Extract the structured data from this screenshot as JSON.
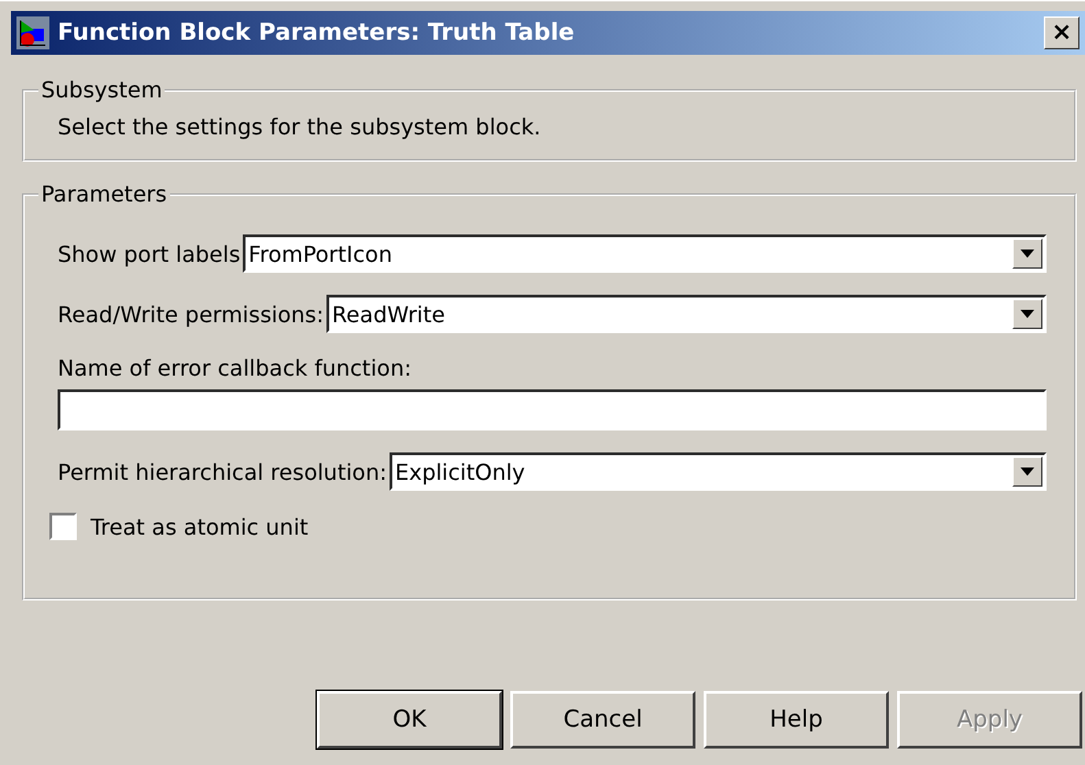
{
  "window": {
    "title": "Function Block Parameters: Truth Table",
    "close": "×"
  },
  "subsystem": {
    "legend": "Subsystem",
    "description": "Select the settings for the subsystem block."
  },
  "parameters": {
    "legend": "Parameters",
    "fields": [
      {
        "kind": "dropdown",
        "label": "Show port labels",
        "value": "FromPortIcon"
      },
      {
        "kind": "dropdown",
        "label": "Read/Write permissions:",
        "value": "ReadWrite"
      },
      {
        "kind": "text",
        "label": "Name of error callback function:"
      },
      {
        "kind": "dropdown",
        "label": "Permit hierarchical resolution:",
        "value": "ExplicitOnly"
      },
      {
        "kind": "checkbox",
        "label": "Treat as atomic unit",
        "checked": false
      }
    ]
  },
  "buttons": [
    {
      "label": "OK",
      "default": true,
      "disabled": false
    },
    {
      "label": "Cancel",
      "default": false,
      "disabled": false
    },
    {
      "label": "Help",
      "default": false,
      "disabled": false
    },
    {
      "label": "Apply",
      "default": false,
      "disabled": true
    }
  ]
}
